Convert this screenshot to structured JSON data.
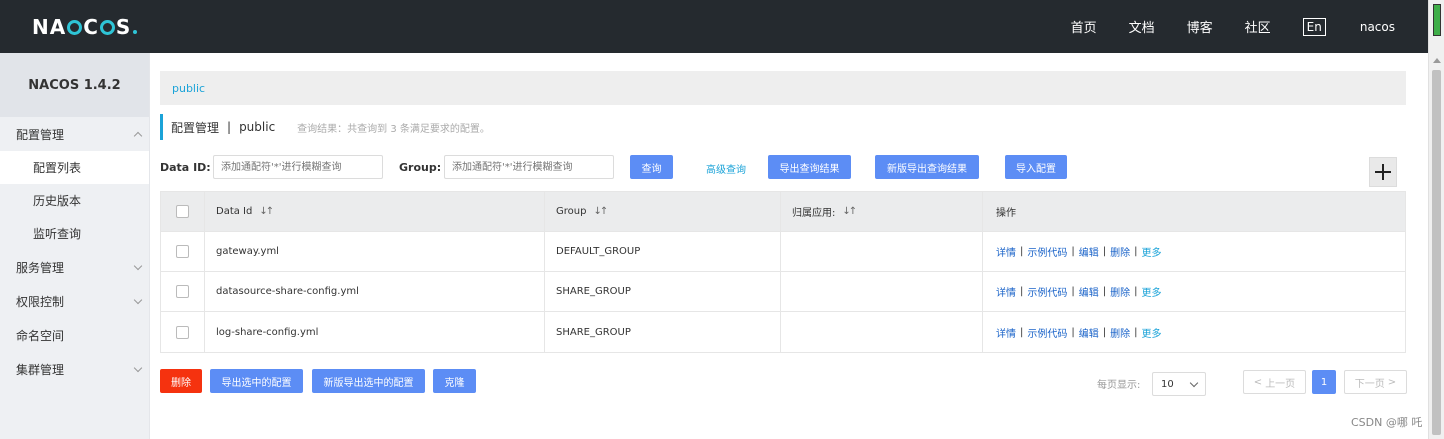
{
  "header": {
    "logo": "NACOS.",
    "nav": [
      "首页",
      "文档",
      "博客",
      "社区"
    ],
    "lang": "En",
    "user": "nacos"
  },
  "sidebar": {
    "version": "NACOS 1.4.2",
    "config_group": "配置管理",
    "config_items": [
      "配置列表",
      "历史版本",
      "监听查询"
    ],
    "groups": [
      "服务管理",
      "权限控制",
      "命名空间",
      "集群管理"
    ]
  },
  "main": {
    "breadcrumb": "public",
    "title": "配置管理",
    "title_sep": "|",
    "namespace": "public",
    "summary": "查询结果：共查询到 3 条满足要求的配置。",
    "filters": {
      "dataid_label": "Data ID:",
      "dataid_placeholder": "添加通配符'*'进行模糊查询",
      "group_label": "Group:",
      "group_placeholder": "添加通配符'*'进行模糊查询",
      "query": "查询",
      "advanced": "高级查询",
      "export": "导出查询结果",
      "export_new": "新版导出查询结果",
      "import": "导入配置"
    },
    "table": {
      "headers": [
        "Data Id",
        "Group",
        "归属应用:",
        "操作"
      ],
      "rows": [
        {
          "dataid": "gateway.yml",
          "group": "DEFAULT_GROUP",
          "app": ""
        },
        {
          "dataid": "datasource-share-config.yml",
          "group": "SHARE_GROUP",
          "app": ""
        },
        {
          "dataid": "log-share-config.yml",
          "group": "SHARE_GROUP",
          "app": ""
        }
      ],
      "ops": [
        "详情",
        "示例代码",
        "编辑",
        "删除",
        "更多"
      ]
    },
    "footer": {
      "delete": "删除",
      "export_selected": "导出选中的配置",
      "export_selected_new": "新版导出选中的配置",
      "clone": "克隆",
      "page_size_label": "每页显示:",
      "page_size": "10",
      "prev": "上一页",
      "page": "1",
      "next": "下一页"
    }
  },
  "watermark": "CSDN @哪 吒"
}
